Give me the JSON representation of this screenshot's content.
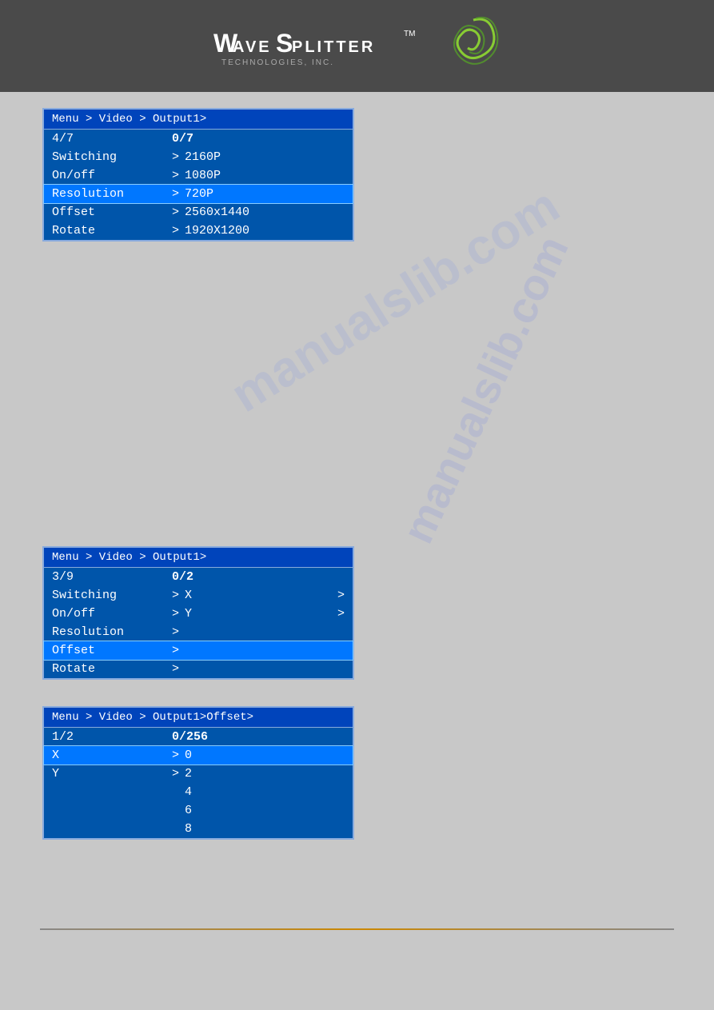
{
  "header": {
    "logo_main": "WaveSplitter",
    "logo_sub": "TECHNOLOGIES, INC.",
    "logo_wave_part": "WAVE",
    "logo_splitter_part": "SPLITTER"
  },
  "watermark": {
    "line1": "manualslib",
    "text": "manualslib.com"
  },
  "panel1": {
    "breadcrumb": "Menu > Video > Output1>",
    "counter": {
      "current": "4/7",
      "total": "0/7"
    },
    "rows": [
      {
        "label": "Switching",
        "arrow": ">",
        "value": "2160P",
        "selected": false
      },
      {
        "label": "On/off",
        "arrow": ">",
        "value": "1080P",
        "selected": false
      },
      {
        "label": "Resolution",
        "arrow": ">",
        "value": "720P",
        "selected": true
      },
      {
        "label": "Offset",
        "arrow": ">",
        "value": "2560x1440",
        "selected": false
      },
      {
        "label": "Rotate",
        "arrow": ">",
        "value": "1920X1200",
        "selected": false
      }
    ]
  },
  "panel2": {
    "breadcrumb": "Menu > Video > Output1>",
    "counter": {
      "current": "3/9",
      "total": "0/2"
    },
    "rows": [
      {
        "label": "Switching",
        "arrow": ">",
        "value": "X",
        "right_arrow": ">",
        "selected": false
      },
      {
        "label": "On/off",
        "arrow": ">",
        "value": "Y",
        "right_arrow": ">",
        "selected": false
      },
      {
        "label": "Resolution",
        "arrow": ">",
        "value": "",
        "right_arrow": "",
        "selected": false
      },
      {
        "label": "Offset",
        "arrow": ">",
        "value": "",
        "right_arrow": "",
        "selected": true
      },
      {
        "label": "Rotate",
        "arrow": ">",
        "value": "",
        "right_arrow": "",
        "selected": false
      }
    ]
  },
  "panel3": {
    "breadcrumb": "Menu > Video > Output1>Offset>",
    "counter": {
      "current": "1/2",
      "total": "0/256"
    },
    "rows": [
      {
        "label": "X",
        "arrow": ">",
        "value": "0",
        "selected": true
      },
      {
        "label": "Y",
        "arrow": ">",
        "value": "2",
        "selected": false
      }
    ],
    "extra_values": [
      "4",
      "6",
      "8"
    ]
  }
}
